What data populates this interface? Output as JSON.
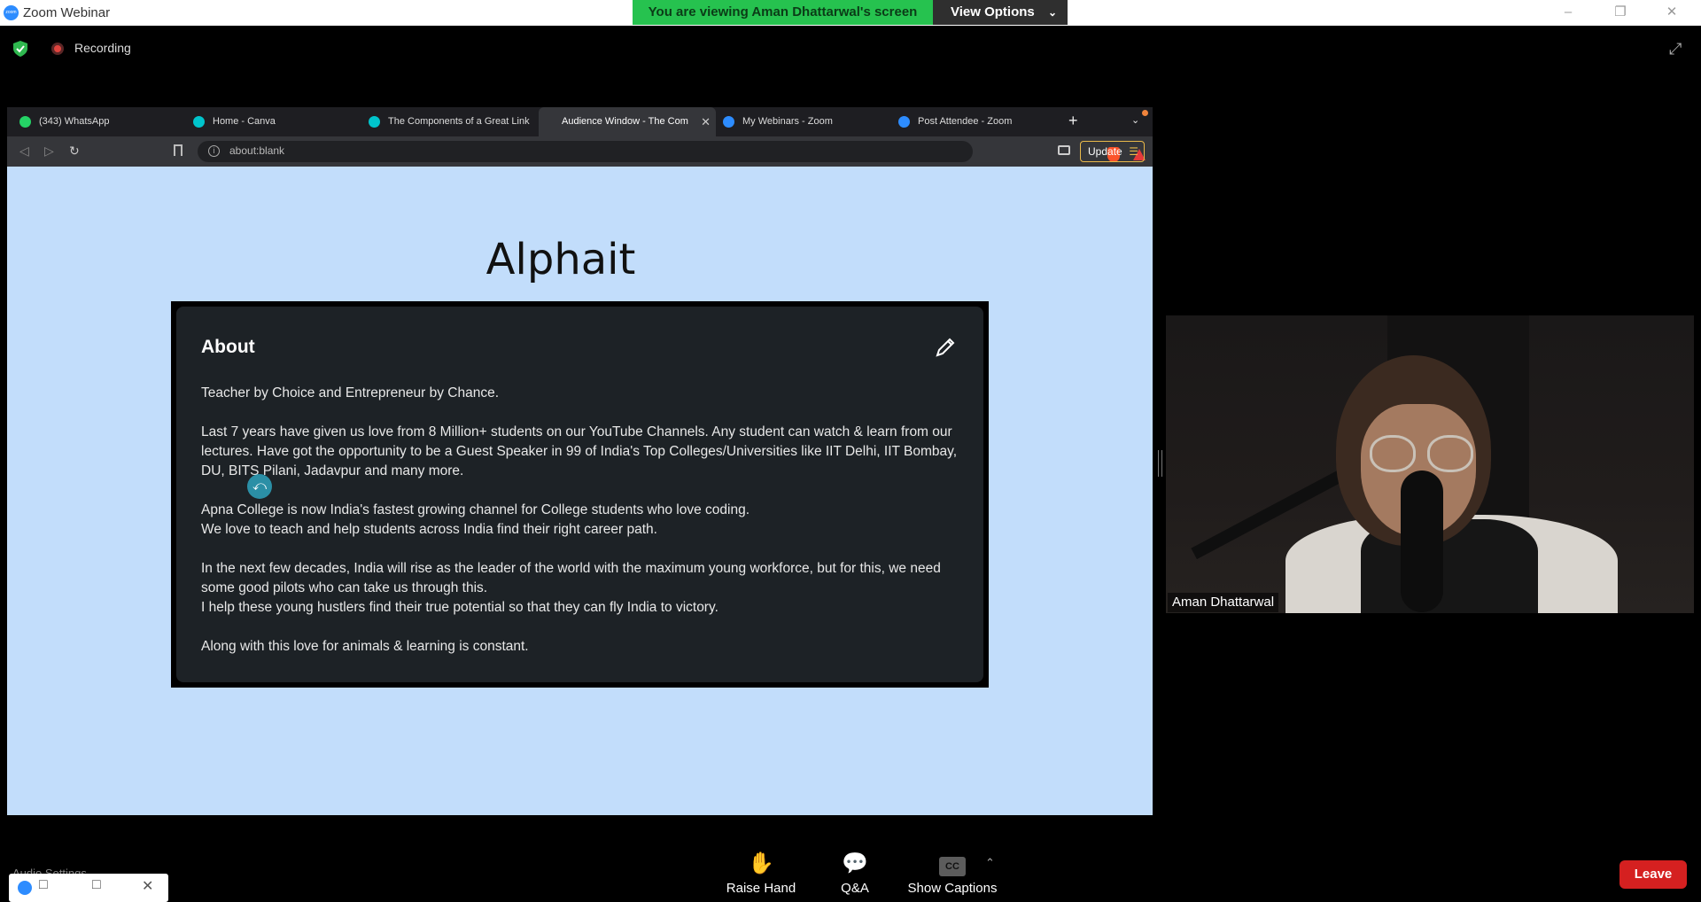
{
  "window": {
    "title": "Zoom Webinar",
    "banner": "You are viewing Aman Dhattarwal's screen",
    "view_options": "View Options",
    "controls": [
      "–",
      "❐",
      "✕"
    ]
  },
  "meeting": {
    "recording_label": "Recording"
  },
  "browser": {
    "tabs": [
      {
        "label": "(343) WhatsApp",
        "favicon_color": "#25d366"
      },
      {
        "label": "Home - Canva",
        "favicon_color": "#00c4cc"
      },
      {
        "label": "The Components of a Great Link",
        "favicon_color": "#00c4cc"
      },
      {
        "label": "Audience Window - The Com",
        "favicon_color": "#35363a",
        "active": true
      },
      {
        "label": "My Webinars - Zoom",
        "favicon_color": "#2d8cff"
      },
      {
        "label": "Post Attendee - Zoom",
        "favicon_color": "#2d8cff"
      }
    ],
    "url": "about:blank",
    "update_label": "Update"
  },
  "page": {
    "title": "Alphait",
    "about": {
      "heading": "About",
      "paragraphs": [
        "Teacher by Choice and Entrepreneur by Chance.",
        "Last 7 years have given us love from 8 Million+ students on our YouTube Channels. Any student can watch & learn from our lectures. Have got the opportunity to be a Guest Speaker in 99 of India's Top Colleges/Universities like IIT Delhi, IIT Bombay, DU, BITS Pilani, Jadavpur and many more.",
        "Apna College is now India's fastest growing channel for College students who love coding.\nWe love to teach and help students across India find their right career path.",
        "In the next few decades, India will rise as the leader of the world with the maximum young workforce, but for this, we need some good pilots who can take us through this.\nI help these young hustlers find their true potential so that they can fly India to victory.",
        "Along with this love for animals & learning is constant."
      ]
    }
  },
  "participant": {
    "name": "Aman Dhattarwal"
  },
  "toolbar": {
    "raise_hand": "Raise Hand",
    "qa": "Q&A",
    "show_captions": "Show Captions",
    "cc": "CC",
    "leave": "Leave",
    "audio_settings": "Audio Settings"
  },
  "colors": {
    "banner_green": "#26c24f",
    "leave_red": "#d52020",
    "page_bg": "#c2ddfb"
  }
}
